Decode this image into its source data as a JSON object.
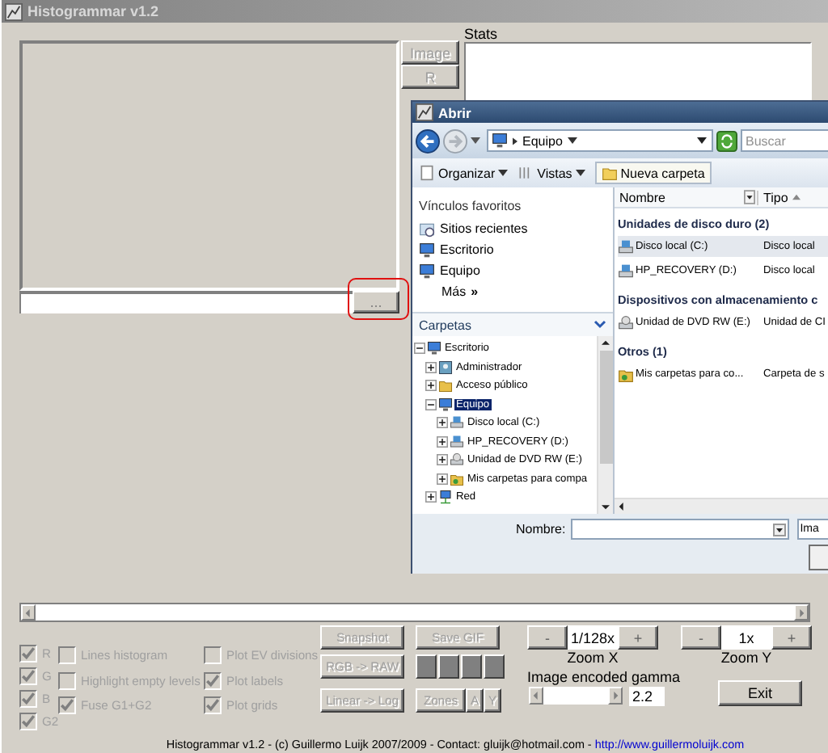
{
  "window": {
    "title": "Histogrammar v1.2"
  },
  "browse_button": {
    "label": "..."
  },
  "side_tabs": [
    {
      "label": "Image",
      "disabled": true
    },
    {
      "label": "R",
      "disabled": true
    }
  ],
  "stats": {
    "label": "Stats"
  },
  "dialog": {
    "title": "Abrir",
    "address": "Equipo",
    "search": {
      "placeholder": "Buscar"
    },
    "toolbar": [
      {
        "label": "Organizar",
        "kind": "menu"
      },
      {
        "label": "Vistas",
        "kind": "menu"
      },
      {
        "label": "Nueva carpeta",
        "kind": "button"
      }
    ],
    "favorites": {
      "title": "Vínculos favoritos",
      "items": [
        {
          "label": "Sitios recientes",
          "kind": "recent"
        },
        {
          "label": "Escritorio",
          "kind": "desktop"
        },
        {
          "label": "Equipo",
          "kind": "computer"
        }
      ],
      "more": "Más",
      "more_icon": "»"
    },
    "folders": {
      "title": "Carpetas",
      "tree": [
        {
          "label": "Escritorio",
          "kind": "desktop",
          "expanded": true,
          "selected": false,
          "children": [
            {
              "label": "Administrador",
              "kind": "user",
              "expanded": false,
              "selected": false
            },
            {
              "label": "Acceso público",
              "kind": "folder",
              "expanded": false,
              "selected": false
            },
            {
              "label": "Equipo",
              "kind": "computer",
              "expanded": true,
              "selected": true,
              "children": [
                {
                  "label": "Disco local (C:)",
                  "kind": "drive",
                  "expanded": false,
                  "selected": false
                },
                {
                  "label": "HP_RECOVERY (D:)",
                  "kind": "drive",
                  "expanded": false,
                  "selected": false
                },
                {
                  "label": "Unidad de DVD RW (E:)",
                  "kind": "dvd",
                  "expanded": false,
                  "selected": false
                },
                {
                  "label": "Mis carpetas para compa",
                  "kind": "shared",
                  "expanded": false,
                  "selected": false
                }
              ]
            },
            {
              "label": "Red",
              "kind": "network",
              "expanded": false,
              "selected": false
            }
          ]
        }
      ]
    },
    "columns": [
      "Nombre",
      "Tipo"
    ],
    "groups": [
      {
        "title": "Unidades de disco duro (2)",
        "items": [
          {
            "name": "Disco local (C:)",
            "type": "Disco local",
            "kind": "drive",
            "selected": true
          },
          {
            "name": "HP_RECOVERY (D:)",
            "type": "Disco local",
            "kind": "drive",
            "selected": false
          }
        ]
      },
      {
        "title": "Dispositivos con almacenamiento c",
        "items": [
          {
            "name": "Unidad de DVD RW (E:)",
            "type": "Unidad de CI",
            "kind": "dvd",
            "selected": false
          }
        ]
      },
      {
        "title": "Otros (1)",
        "items": [
          {
            "name": "Mis carpetas para co...",
            "type": "Carpeta de s",
            "kind": "shared",
            "selected": false
          }
        ]
      }
    ],
    "filename": {
      "label": "Nombre:"
    },
    "filter": {
      "value": "Ima"
    }
  },
  "channels": [
    {
      "label": "R",
      "checked": true,
      "disabled": true
    },
    {
      "label": "G",
      "checked": true,
      "disabled": true
    },
    {
      "label": "B",
      "checked": true,
      "disabled": true
    },
    {
      "label": "G2",
      "checked": true,
      "disabled": true
    }
  ],
  "option_columns": [
    [
      {
        "label": "Lines histogram",
        "checked": false,
        "disabled": true
      },
      {
        "label": "Highlight empty levels",
        "checked": false,
        "disabled": true
      },
      {
        "label": "Fuse G1+G2",
        "checked": true,
        "disabled": true
      }
    ],
    [
      {
        "label": "Plot EV divisions",
        "checked": false,
        "disabled": true
      },
      {
        "label": "Plot labels",
        "checked": true,
        "disabled": true
      },
      {
        "label": "Plot grids",
        "checked": true,
        "disabled": true
      }
    ]
  ],
  "actions": [
    {
      "label": "Snapshot",
      "disabled": true
    },
    {
      "label": "Save GIF",
      "disabled": true
    },
    {
      "label": "RGB -> RAW",
      "disabled": true
    },
    {
      "label": "Linear -> Log",
      "disabled": true
    },
    {
      "label": "Zones",
      "disabled": true
    },
    {
      "label": "A",
      "disabled": true
    },
    {
      "label": "Y",
      "disabled": true
    }
  ],
  "zoom": [
    {
      "label": "Zoom X",
      "value": "1/128x",
      "minus": "-",
      "plus": "+"
    },
    {
      "label": "Zoom Y",
      "value": "1x",
      "minus": "-",
      "plus": "+"
    }
  ],
  "gamma": {
    "label": "Image encoded gamma",
    "value": "2.2"
  },
  "exit": {
    "label": "Exit"
  },
  "footer": {
    "text": "Histogrammar v1.2 - (c) Guillermo Luijk 2007/2009 - Contact: gluijk@hotmail.com - ",
    "link": "http://www.guillermoluijk.com"
  }
}
